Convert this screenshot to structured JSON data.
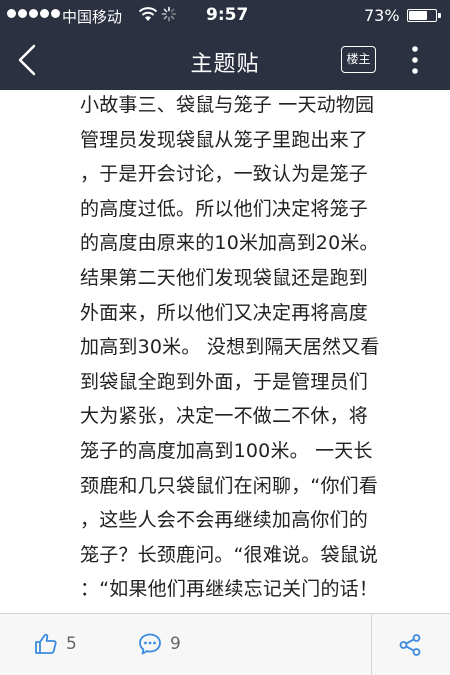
{
  "status_bar": {
    "carrier": "中国移动",
    "time": "9:57",
    "battery_percent_text": "73%",
    "battery_level": 0.73,
    "signal_icon": "signal-dots-icon",
    "wifi_icon": "wifi-icon",
    "activity_icon": "activity-spinner-icon"
  },
  "nav": {
    "back_icon": "chevron-left-icon",
    "title": "主题贴",
    "op_button_label": "楼主",
    "more_icon": "vertical-ellipsis-icon"
  },
  "post": {
    "lines": [
      "小故事三、袋鼠与笼子 一天动物园",
      "管理员发现袋鼠从笼子里跑出来了",
      "，于是开会讨论，一致认为是笼子",
      "的高度过低。所以他们决定将笼子",
      "的高度由原来的10米加高到20米。",
      "结果第二天他们发现袋鼠还是跑到",
      "外面来，所以他们又决定再将高度",
      "加高到30米。 没想到隔天居然又看",
      "到袋鼠全跑到外面，于是管理员们",
      "大为紧张，决定一不做二不休，将",
      "笼子的高度加高到100米。 一天长",
      "颈鹿和几只袋鼠们在闲聊，“你们看",
      "，这些人会不会再继续加高你们的",
      "笼子？长颈鹿问。“很难说。袋鼠说",
      "：“如果他们再继续忘记关门的话！"
    ]
  },
  "bottom_bar": {
    "like_icon": "thumbs-up-icon",
    "like_count": "5",
    "comment_icon": "comment-bubble-icon",
    "comment_count": "9",
    "share_icon": "share-icon"
  },
  "colors": {
    "header_bg": "#2b3140",
    "accent_blue": "#3b8be0",
    "text": "#222222",
    "bottom_bg": "#f7f7f7"
  }
}
